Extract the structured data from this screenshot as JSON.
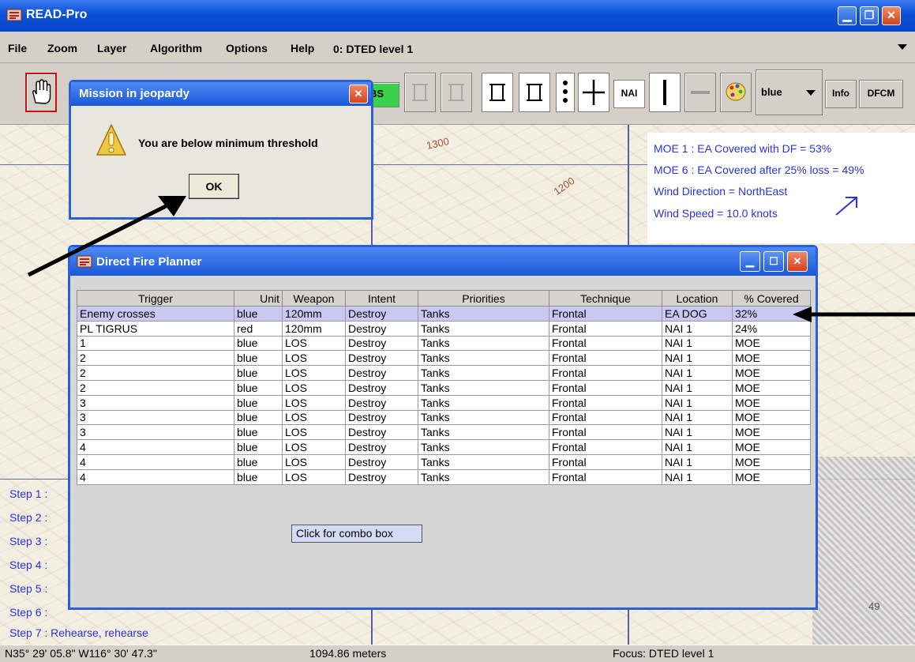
{
  "window": {
    "title": "READ-Pro"
  },
  "menu": [
    "File",
    "Zoom",
    "Layer",
    "Algorithm",
    "Options",
    "Help"
  ],
  "layer_select": {
    "value": "0: DTED level 1"
  },
  "toolbar": {
    "obs_label": "BS",
    "nai_label": "NAI",
    "color_value": "blue",
    "info_label": "Info",
    "dfcm_label": "DFCM"
  },
  "moe": [
    "MOE 1 : EA Covered with DF =  53%",
    "MOE 6 : EA Covered after 25% loss =  49%",
    "Wind Direction = NorthEast",
    "Wind Speed = 10.0 knots"
  ],
  "map_labels": {
    "contour_a": "1300",
    "contour_b": "1200",
    "grid_49": "49"
  },
  "steps": [
    "Step 1 :",
    "Step 2 :",
    "Step 3 :",
    "Step 4 :",
    "Step 5 :",
    "Step 6 :",
    "Step 7 :  Rehearse, rehearse"
  ],
  "status": {
    "coords": "N35° 29' 05.8\"  W116° 30' 47.3\"",
    "distance": "1094.86 meters",
    "focus": "Focus:  DTED level 1"
  },
  "dialog": {
    "title": "Mission in jeopardy",
    "message": "You are below minimum threshold",
    "ok": "OK"
  },
  "planner": {
    "title": "Direct Fire Planner",
    "columns": [
      "Trigger",
      "Unit",
      "Weapon",
      "Intent",
      "Priorities",
      "Technique",
      "Location",
      "% Covered"
    ],
    "rows": [
      [
        "Enemy crosses",
        "blue",
        "120mm",
        "Destroy",
        "Tanks",
        "Frontal",
        "EA DOG",
        "32%"
      ],
      [
        "PL TIGRUS",
        "red",
        "120mm",
        "Destroy",
        "Tanks",
        "Frontal",
        "NAI 1",
        "24%"
      ],
      [
        "1",
        "blue",
        "LOS",
        "Destroy",
        "Tanks",
        "Frontal",
        "NAI 1",
        "MOE"
      ],
      [
        "2",
        "blue",
        "LOS",
        "Destroy",
        "Tanks",
        "Frontal",
        "NAI 1",
        "MOE"
      ],
      [
        "2",
        "blue",
        "LOS",
        "Destroy",
        "Tanks",
        "Frontal",
        "NAI 1",
        "MOE"
      ],
      [
        "2",
        "blue",
        "LOS",
        "Destroy",
        "Tanks",
        "Frontal",
        "NAI 1",
        "MOE"
      ],
      [
        "3",
        "blue",
        "LOS",
        "Destroy",
        "Tanks",
        "Frontal",
        "NAI 1",
        "MOE"
      ],
      [
        "3",
        "blue",
        "LOS",
        "Destroy",
        "Tanks",
        "Frontal",
        "NAI 1",
        "MOE"
      ],
      [
        "3",
        "blue",
        "LOS",
        "Destroy",
        "Tanks",
        "Frontal",
        "NAI 1",
        "MOE"
      ],
      [
        "4",
        "blue",
        "LOS",
        "Destroy",
        "Tanks",
        "Frontal",
        "NAI 1",
        "MOE"
      ],
      [
        "4",
        "blue",
        "LOS",
        "Destroy",
        "Tanks",
        "Frontal",
        "NAI 1",
        "MOE"
      ],
      [
        "4",
        "blue",
        "LOS",
        "Destroy",
        "Tanks",
        "Frontal",
        "NAI 1",
        "MOE"
      ]
    ],
    "tooltip": "Click for combo box"
  }
}
